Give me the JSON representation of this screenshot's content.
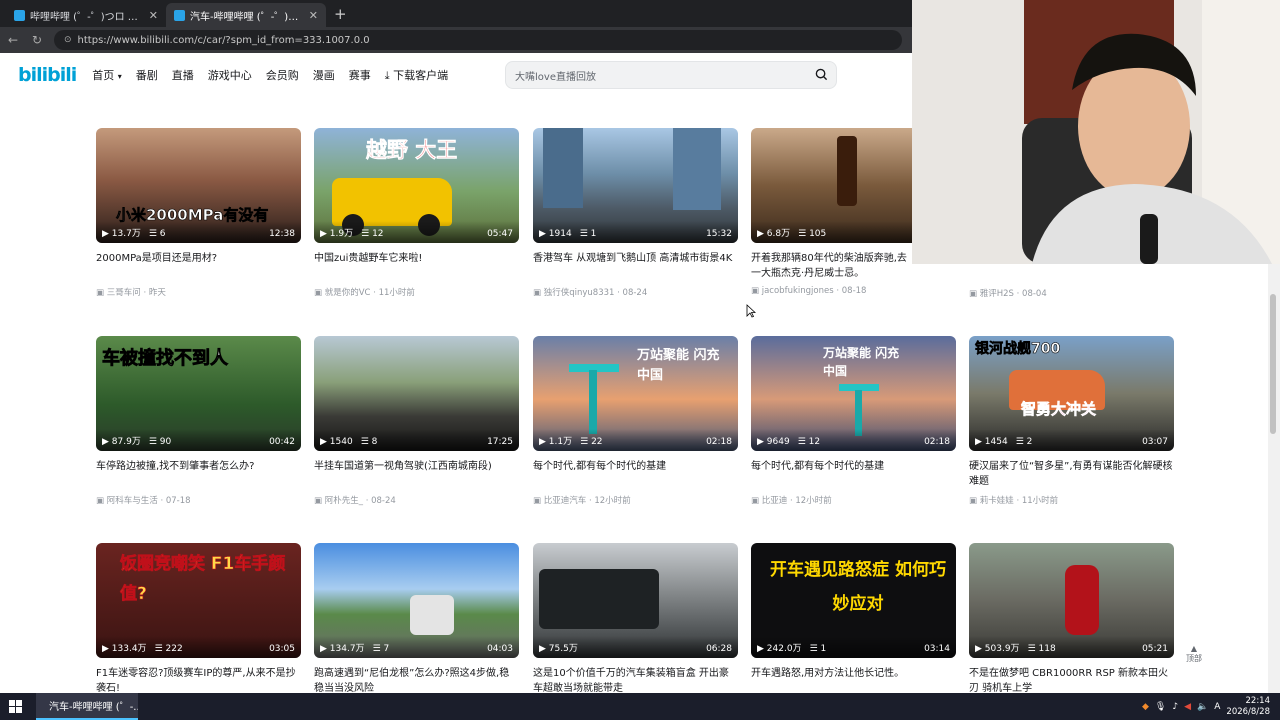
{
  "browser": {
    "tabs": [
      {
        "title": "哔哩哔哩 (゜-゜)つロ 干杯~-bilibili",
        "active": false
      },
      {
        "title": "汽车-哔哩哔哩 (゜-゜)つロ 干杯~-bili...",
        "active": true
      }
    ],
    "url": "https://www.bilibili.com/c/car/?spm_id_from=333.1007.0.0"
  },
  "site": {
    "logo": "bilibili",
    "nav": [
      "首页",
      "番剧",
      "直播",
      "游戏中心",
      "会员购",
      "漫画",
      "赛事",
      "下载客户端"
    ],
    "search_placeholder": "大嘴love直播回放"
  },
  "videos": [
    {
      "views": "13.7万",
      "danmaku": "6",
      "duration": "12:38",
      "title": "2000MPa是项目还是用材?",
      "author": "三哥车问",
      "date": "昨天",
      "overlay": "小米2000MPa有没有"
    },
    {
      "views": "1.9万",
      "danmaku": "12",
      "duration": "05:47",
      "title": "中国zui贵越野车它来啦!",
      "author": "就是你的VC",
      "date": "11小时前",
      "overlay": "越野 大王"
    },
    {
      "views": "1914",
      "danmaku": "1",
      "duration": "15:32",
      "title": "香港驾车 从观塘到飞鹅山顶 高清城市街景4K",
      "author": "独行侠qinyu8331",
      "date": "08-24",
      "overlay": ""
    },
    {
      "views": "6.8万",
      "danmaku": "105",
      "duration": "",
      "title": "开着我那辆80年代的柴油版奔驰,去一大瓶杰克·丹尼威士忌。",
      "author": "jacobfukingjones",
      "date": "08-18",
      "overlay": ""
    },
    {
      "views": "",
      "danmaku": "",
      "duration": "",
      "title": "",
      "author": "雅评H2S",
      "date": "08-04",
      "overlay": ""
    },
    {
      "views": "87.9万",
      "danmaku": "90",
      "duration": "00:42",
      "title": "车停路边被撞,找不到肇事者怎么办?",
      "author": "阿科车与生活",
      "date": "07-18",
      "overlay": "车被撞找不到人"
    },
    {
      "views": "1540",
      "danmaku": "8",
      "duration": "17:25",
      "title": "半挂车国道第一视角驾驶(江西南城南段)",
      "author": "阿朴先生_",
      "date": "08-24",
      "overlay": ""
    },
    {
      "views": "1.1万",
      "danmaku": "22",
      "duration": "02:18",
      "title": "每个时代,都有每个时代的基建",
      "author": "比亚迪汽车",
      "date": "12小时前",
      "overlay": "万站聚能 闪充中国"
    },
    {
      "views": "9649",
      "danmaku": "12",
      "duration": "02:18",
      "title": "每个时代,都有每个时代的基建",
      "author": "比亚迪",
      "date": "12小时前",
      "overlay": "万站聚能 闪充中国"
    },
    {
      "views": "1454",
      "danmaku": "2",
      "duration": "03:07",
      "title": "硬汉届来了位“智多星”,有勇有谋能否化解硬核难题",
      "author": "莉卡娃娃",
      "date": "11小时前",
      "overlay": "银河战舰700"
    },
    {
      "views": "133.4万",
      "danmaku": "222",
      "duration": "03:05",
      "title": "F1车迷零容忍?顶级赛车IP的尊严,从来不是抄袭石!",
      "author": "",
      "date": "",
      "overlay": "饭圈竞嘲笑 F1车手颜值?"
    },
    {
      "views": "134.7万",
      "danmaku": "7",
      "duration": "04:03",
      "title": "跑高速遇到“尼伯龙根”怎么办?照这4步做,稳稳当当没风险",
      "author": "",
      "date": "",
      "overlay": ""
    },
    {
      "views": "75.5万",
      "danmaku": "",
      "duration": "06:28",
      "title": "这是10个价值千万的汽车集装箱盲盒 开出豪车超敢当场就能带走",
      "author": "",
      "date": "",
      "overlay": ""
    },
    {
      "views": "242.0万",
      "danmaku": "1",
      "duration": "03:14",
      "title": "开车遇路怒,用对方法让他长记性。",
      "author": "",
      "date": "",
      "overlay": "开车遇见路怒症 如何巧妙应对"
    },
    {
      "views": "503.9万",
      "danmaku": "118",
      "duration": "05:21",
      "title": "不是在做梦吧 CBR1000RR RSP 新款本田火刃 骑机车上学",
      "author": "",
      "date": "",
      "overlay": ""
    }
  ],
  "totop_label": "顶部",
  "taskbar": {
    "app_title": "汽车-哔哩哔哩 (゜-...",
    "time": "22:14",
    "date": "2026/8/28",
    "ime": "A"
  }
}
